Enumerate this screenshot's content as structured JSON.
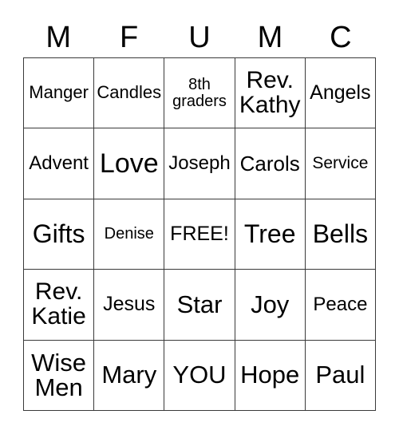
{
  "card": {
    "header_letters": [
      "M",
      "F",
      "U",
      "M",
      "C"
    ],
    "rows": [
      [
        {
          "label": "Manger",
          "size": "fs-22"
        },
        {
          "label": "Candles",
          "size": "fs-22"
        },
        {
          "label": "8th\ngraders",
          "size": "fs-20"
        },
        {
          "label": "Rev.\nKathy",
          "size": "fs-30"
        },
        {
          "label": "Angels",
          "size": "fs-25"
        }
      ],
      [
        {
          "label": "Advent",
          "size": "fs-24"
        },
        {
          "label": "Love",
          "size": "fs-34"
        },
        {
          "label": "Joseph",
          "size": "fs-24"
        },
        {
          "label": "Carols",
          "size": "fs-26"
        },
        {
          "label": "Service",
          "size": "fs-21"
        }
      ],
      [
        {
          "label": "Gifts",
          "size": "fs-32"
        },
        {
          "label": "Denise",
          "size": "fs-20"
        },
        {
          "label": "FREE!",
          "size": "fs-25"
        },
        {
          "label": "Tree",
          "size": "fs-32"
        },
        {
          "label": "Bells",
          "size": "fs-32"
        }
      ],
      [
        {
          "label": "Rev.\nKatie",
          "size": "fs-30"
        },
        {
          "label": "Jesus",
          "size": "fs-25"
        },
        {
          "label": "Star",
          "size": "fs-31"
        },
        {
          "label": "Joy",
          "size": "fs-31"
        },
        {
          "label": "Peace",
          "size": "fs-24"
        }
      ],
      [
        {
          "label": "Wise\nMen",
          "size": "fs-31"
        },
        {
          "label": "Mary",
          "size": "fs-31"
        },
        {
          "label": "YOU",
          "size": "fs-31"
        },
        {
          "label": "Hope",
          "size": "fs-31"
        },
        {
          "label": "Paul",
          "size": "fs-31"
        }
      ]
    ]
  },
  "colors": {
    "border": "#3a3a3a",
    "text": "#000000",
    "background": "#ffffff"
  }
}
